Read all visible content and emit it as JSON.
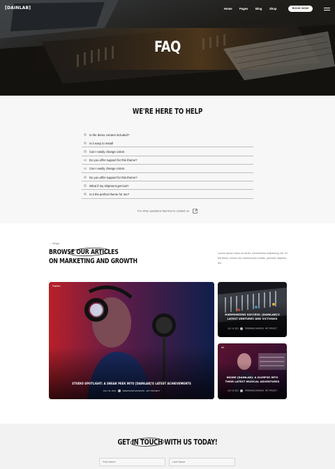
{
  "nav": {
    "logo": "[DAINLAB]",
    "links": [
      "Home",
      "Pages",
      "Blog",
      "Shop"
    ],
    "book_button": "BOOK NOW"
  },
  "hero": {
    "title": "FAQ"
  },
  "faq": {
    "heading": "WE'RE HERE TO HELP",
    "questions": [
      "Is the demo content included?",
      "Is it easy to install",
      "Can I easily change colors",
      "Do you offer support for this theme?",
      "Can I easily change colors",
      "Do you offer support for this theme?",
      "What if my shipment get lost?",
      "Is it the perfect theme for me?"
    ],
    "contact_text": "For other questions feel free to contact us"
  },
  "blog": {
    "breadcrumb": "← Blogs",
    "title_line1": "BROWSE OUR ARTICLES",
    "title_line2": "ON MARKETING AND GROWTH",
    "description": "Lorem ipsum dolor sit amet, consectetur adipiscing elit. Ut elit tellus, luctus nec ullamcorper mattis, pulvinar dapibus leo.",
    "cards": [
      {
        "tag": "Fashion",
        "title": "STUDIO SPOTLIGHT: A SNEAK PEEK INTO [DAINLAB]'S LATEST ACHIEVEMENTS",
        "date": "JULY 16, 2023",
        "author": "FERDINAND DAVIDSON",
        "category": "ART, PROJECT"
      },
      {
        "tag": "",
        "title": "HARMONIZING SUCCESS: [DAINLAB]'S LATEST VENTURES AND VICTORIES",
        "date": "JULY 16, 2023",
        "author": "FERDINAND DAVIDSON",
        "category": "ART, PROJECT"
      },
      {
        "tag": "Art",
        "title": "INSIDE [DAINLAB]: A GLIMPSE INTO THEIR LATEST MUSICAL ADVENTURES",
        "date": "JULY 16, 2023",
        "author": "FERDINAND DAVIDSON",
        "category": "ART, PROJECT"
      }
    ]
  },
  "contact": {
    "title": "GET IN TOUCH WITH US TODAY!",
    "first_name_placeholder": "First Name",
    "last_name_placeholder": "Last Name"
  },
  "colors": {
    "hero_overlay": "#15130f",
    "faq_bg": "#f7f7f7",
    "contact_bg": "#f2f2f2",
    "accent_warm": "#d98a2c"
  }
}
